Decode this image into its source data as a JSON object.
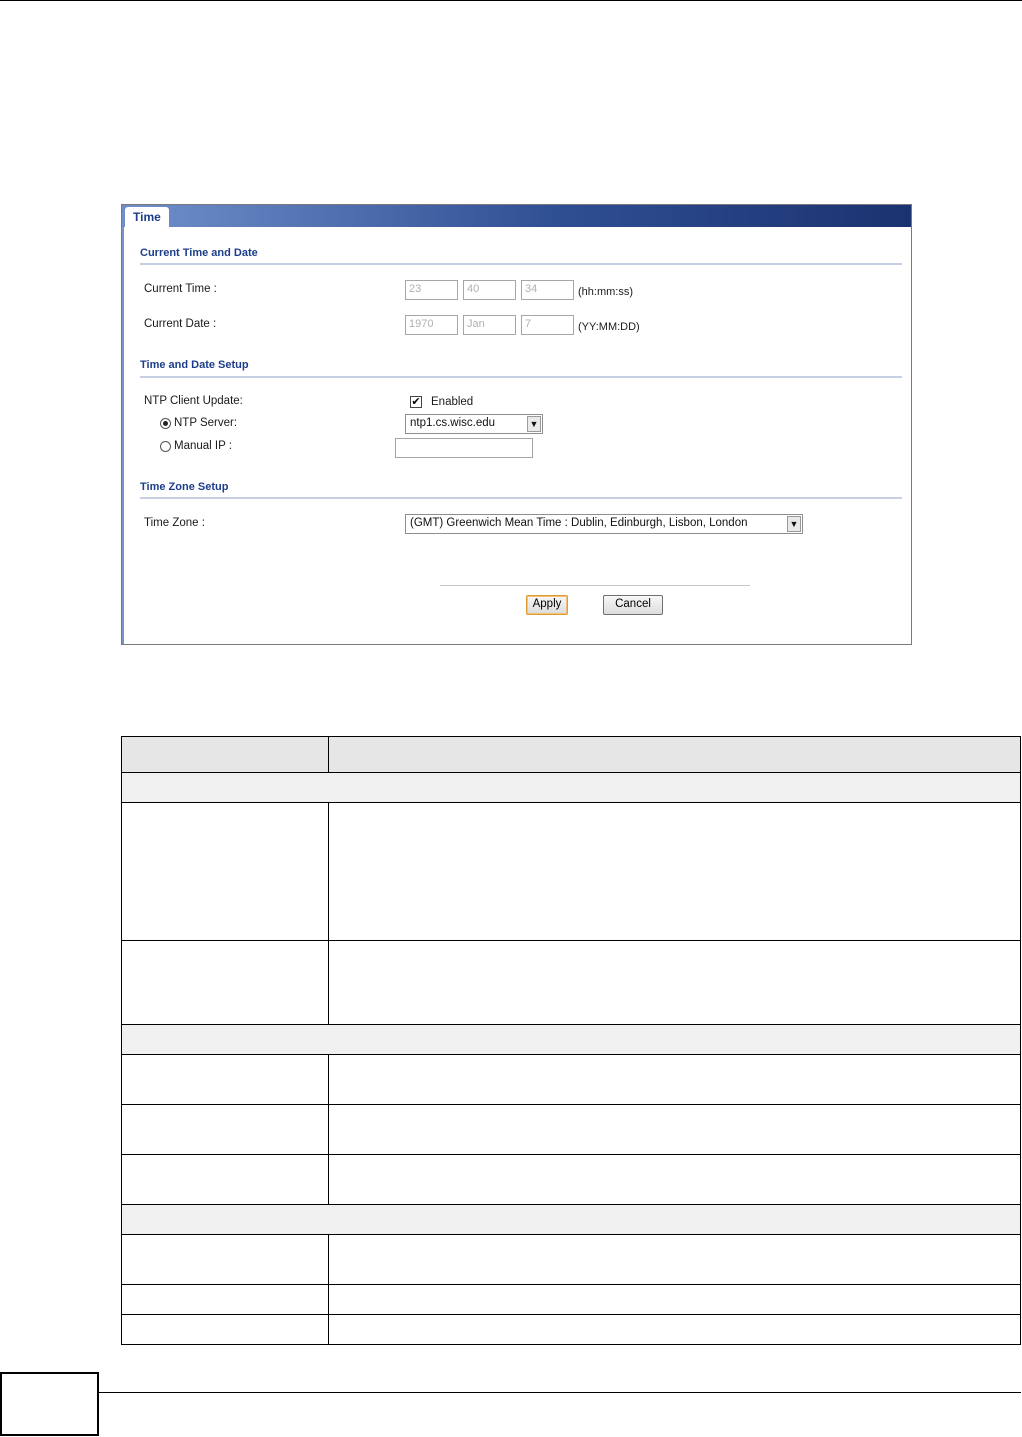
{
  "panel": {
    "tab_label": "Time",
    "sections": {
      "current": "Current Time and Date",
      "setup": "Time and Date Setup",
      "zone": "Time Zone Setup"
    },
    "current_time": {
      "label": "Current Time :",
      "hh": "23",
      "mm": "40",
      "ss": "34",
      "format": "(hh:mm:ss)"
    },
    "current_date": {
      "label": "Current Date :",
      "yy": "1970",
      "mm": "Jan",
      "dd": "7",
      "format": "(YY:MM:DD)"
    },
    "ntp": {
      "label": "NTP Client Update:",
      "enabled_label": "Enabled",
      "enabled_check": "✔",
      "server_label": "NTP Server:",
      "server_value": "ntp1.cs.wisc.edu",
      "manual_label": "Manual IP :",
      "manual_value": ""
    },
    "timezone": {
      "label": "Time Zone :",
      "value": "(GMT) Greenwich Mean Time : Dublin, Edinburgh, Lisbon, London"
    },
    "buttons": {
      "apply": "Apply",
      "cancel": "Cancel"
    }
  }
}
